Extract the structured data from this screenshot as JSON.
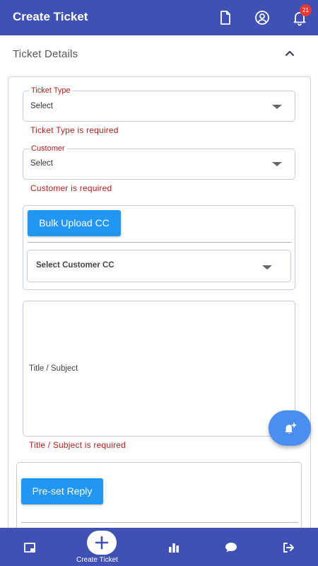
{
  "header": {
    "title": "Create Ticket",
    "notification_count": "21",
    "icons": [
      "document-icon",
      "account-circle-icon",
      "bell-icon"
    ],
    "bar_color": "#3f51b5"
  },
  "section": {
    "title": "Ticket Details",
    "state_icon": "chevron-up-icon"
  },
  "form": {
    "ticket_type": {
      "label": "Ticket Type",
      "value": "Select",
      "error": "Ticket Type is required"
    },
    "customer": {
      "label": "Customer",
      "value": "Select",
      "error": "Customer is required"
    },
    "cc": {
      "bulk_upload_label": "Bulk Upload CC",
      "select_placeholder": "Select Customer CC"
    },
    "subject": {
      "label": "Title / Subject",
      "error": "Title / Subject is required"
    },
    "reply": {
      "preset_label": "Pre-set Reply"
    },
    "error_color": "#b71c1c",
    "button_color": "#2196f3"
  },
  "fab": {
    "icon": "add-alert-icon"
  },
  "bottom_nav": {
    "items": [
      {
        "icon": "ticket-icon"
      },
      {
        "icon": "plus-icon",
        "label": "Create Ticket"
      },
      {
        "icon": "bar-chart-icon"
      },
      {
        "icon": "chat-icon"
      },
      {
        "icon": "logout-icon"
      }
    ]
  }
}
